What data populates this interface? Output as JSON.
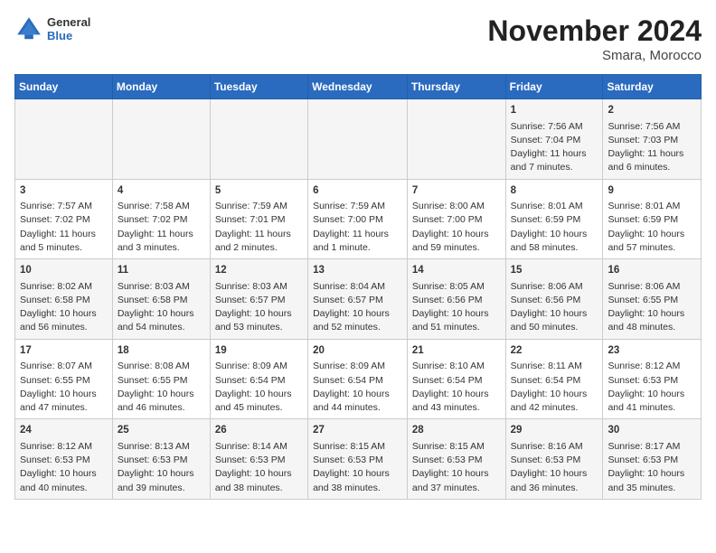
{
  "header": {
    "logo_general": "General",
    "logo_blue": "Blue",
    "title": "November 2024",
    "subtitle": "Smara, Morocco"
  },
  "calendar": {
    "days_of_week": [
      "Sunday",
      "Monday",
      "Tuesday",
      "Wednesday",
      "Thursday",
      "Friday",
      "Saturday"
    ],
    "weeks": [
      [
        {
          "day": "",
          "text": ""
        },
        {
          "day": "",
          "text": ""
        },
        {
          "day": "",
          "text": ""
        },
        {
          "day": "",
          "text": ""
        },
        {
          "day": "",
          "text": ""
        },
        {
          "day": "1",
          "text": "Sunrise: 7:56 AM\nSunset: 7:04 PM\nDaylight: 11 hours and 7 minutes."
        },
        {
          "day": "2",
          "text": "Sunrise: 7:56 AM\nSunset: 7:03 PM\nDaylight: 11 hours and 6 minutes."
        }
      ],
      [
        {
          "day": "3",
          "text": "Sunrise: 7:57 AM\nSunset: 7:02 PM\nDaylight: 11 hours and 5 minutes."
        },
        {
          "day": "4",
          "text": "Sunrise: 7:58 AM\nSunset: 7:02 PM\nDaylight: 11 hours and 3 minutes."
        },
        {
          "day": "5",
          "text": "Sunrise: 7:59 AM\nSunset: 7:01 PM\nDaylight: 11 hours and 2 minutes."
        },
        {
          "day": "6",
          "text": "Sunrise: 7:59 AM\nSunset: 7:00 PM\nDaylight: 11 hours and 1 minute."
        },
        {
          "day": "7",
          "text": "Sunrise: 8:00 AM\nSunset: 7:00 PM\nDaylight: 10 hours and 59 minutes."
        },
        {
          "day": "8",
          "text": "Sunrise: 8:01 AM\nSunset: 6:59 PM\nDaylight: 10 hours and 58 minutes."
        },
        {
          "day": "9",
          "text": "Sunrise: 8:01 AM\nSunset: 6:59 PM\nDaylight: 10 hours and 57 minutes."
        }
      ],
      [
        {
          "day": "10",
          "text": "Sunrise: 8:02 AM\nSunset: 6:58 PM\nDaylight: 10 hours and 56 minutes."
        },
        {
          "day": "11",
          "text": "Sunrise: 8:03 AM\nSunset: 6:58 PM\nDaylight: 10 hours and 54 minutes."
        },
        {
          "day": "12",
          "text": "Sunrise: 8:03 AM\nSunset: 6:57 PM\nDaylight: 10 hours and 53 minutes."
        },
        {
          "day": "13",
          "text": "Sunrise: 8:04 AM\nSunset: 6:57 PM\nDaylight: 10 hours and 52 minutes."
        },
        {
          "day": "14",
          "text": "Sunrise: 8:05 AM\nSunset: 6:56 PM\nDaylight: 10 hours and 51 minutes."
        },
        {
          "day": "15",
          "text": "Sunrise: 8:06 AM\nSunset: 6:56 PM\nDaylight: 10 hours and 50 minutes."
        },
        {
          "day": "16",
          "text": "Sunrise: 8:06 AM\nSunset: 6:55 PM\nDaylight: 10 hours and 48 minutes."
        }
      ],
      [
        {
          "day": "17",
          "text": "Sunrise: 8:07 AM\nSunset: 6:55 PM\nDaylight: 10 hours and 47 minutes."
        },
        {
          "day": "18",
          "text": "Sunrise: 8:08 AM\nSunset: 6:55 PM\nDaylight: 10 hours and 46 minutes."
        },
        {
          "day": "19",
          "text": "Sunrise: 8:09 AM\nSunset: 6:54 PM\nDaylight: 10 hours and 45 minutes."
        },
        {
          "day": "20",
          "text": "Sunrise: 8:09 AM\nSunset: 6:54 PM\nDaylight: 10 hours and 44 minutes."
        },
        {
          "day": "21",
          "text": "Sunrise: 8:10 AM\nSunset: 6:54 PM\nDaylight: 10 hours and 43 minutes."
        },
        {
          "day": "22",
          "text": "Sunrise: 8:11 AM\nSunset: 6:54 PM\nDaylight: 10 hours and 42 minutes."
        },
        {
          "day": "23",
          "text": "Sunrise: 8:12 AM\nSunset: 6:53 PM\nDaylight: 10 hours and 41 minutes."
        }
      ],
      [
        {
          "day": "24",
          "text": "Sunrise: 8:12 AM\nSunset: 6:53 PM\nDaylight: 10 hours and 40 minutes."
        },
        {
          "day": "25",
          "text": "Sunrise: 8:13 AM\nSunset: 6:53 PM\nDaylight: 10 hours and 39 minutes."
        },
        {
          "day": "26",
          "text": "Sunrise: 8:14 AM\nSunset: 6:53 PM\nDaylight: 10 hours and 38 minutes."
        },
        {
          "day": "27",
          "text": "Sunrise: 8:15 AM\nSunset: 6:53 PM\nDaylight: 10 hours and 38 minutes."
        },
        {
          "day": "28",
          "text": "Sunrise: 8:15 AM\nSunset: 6:53 PM\nDaylight: 10 hours and 37 minutes."
        },
        {
          "day": "29",
          "text": "Sunrise: 8:16 AM\nSunset: 6:53 PM\nDaylight: 10 hours and 36 minutes."
        },
        {
          "day": "30",
          "text": "Sunrise: 8:17 AM\nSunset: 6:53 PM\nDaylight: 10 hours and 35 minutes."
        }
      ]
    ]
  }
}
